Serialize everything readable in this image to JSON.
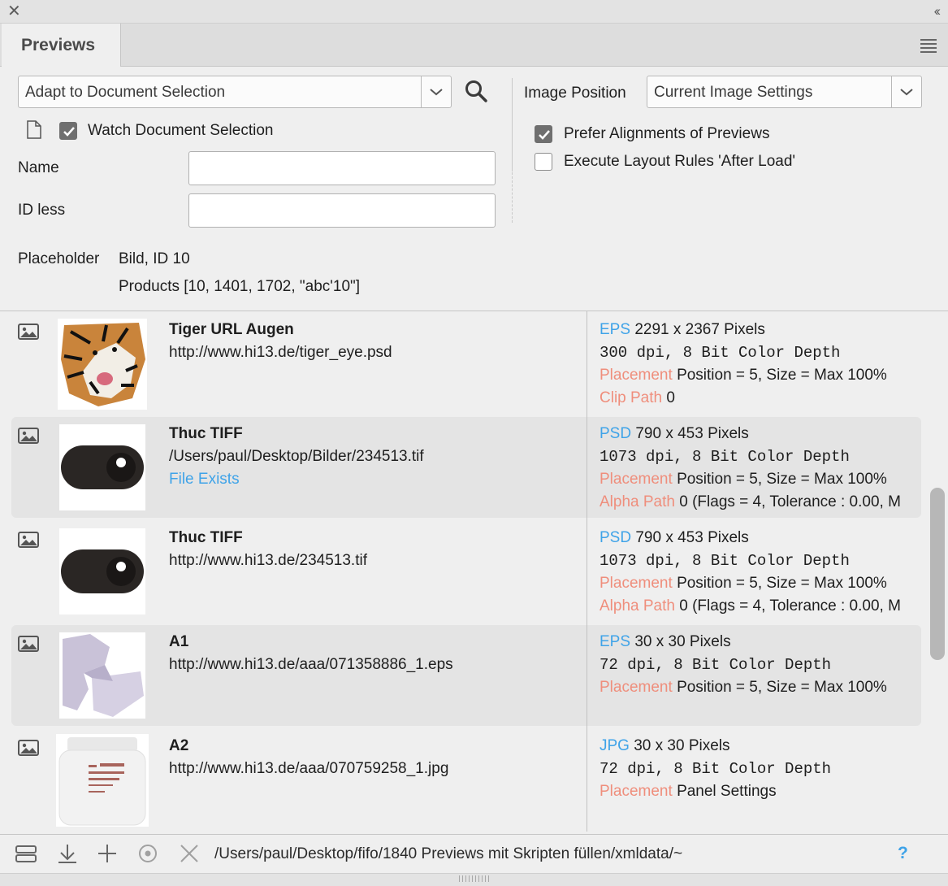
{
  "window": {
    "close_glyph": "✕",
    "collapse_glyph": "‹‹"
  },
  "tab": {
    "label": "Previews"
  },
  "search": {
    "mode_value": "Adapt to Document Selection",
    "watch_label": "Watch Document Selection",
    "watch_checked": true
  },
  "fields": {
    "name_label": "Name",
    "name_value": "",
    "idless_label": "ID less",
    "idless_value": ""
  },
  "placeholder": {
    "label": "Placeholder",
    "line1": "Bild, ID 10",
    "line2": "Products [10, 1401, 1702, \"abc'10\"]"
  },
  "image_position": {
    "label": "Image Position",
    "value": "Current Image Settings",
    "prefer_label": "Prefer Alignments of Previews",
    "prefer_checked": true,
    "execute_label": "Execute Layout Rules 'After Load'",
    "execute_checked": false
  },
  "rows": [
    {
      "title": "Tiger URL Augen",
      "url": "http://www.hi13.de/tiger_eye.psd",
      "exists": "",
      "format": "EPS",
      "size": "2291 x 2367 Pixels",
      "dpi": "300 dpi, 8 Bit Color Depth",
      "k3": "Placement",
      "v3": "Position = 5, Size = Max 100%",
      "k4": "Clip Path",
      "v4": "0",
      "thumb": "tiger"
    },
    {
      "title": "Thuc TIFF",
      "url": "/Users/paul/Desktop/Bilder/234513.tif",
      "exists": "File Exists",
      "format": "PSD",
      "size": "790 x 453 Pixels",
      "dpi": "1073 dpi, 8 Bit Color Depth",
      "k3": "Placement",
      "v3": "Position = 5, Size = Max 100%",
      "k4": "Alpha Path",
      "v4": "0 (Flags = 4, Tolerance : 0.00, M",
      "thumb": "toggle"
    },
    {
      "title": "Thuc TIFF",
      "url": "http://www.hi13.de/234513.tif",
      "exists": "",
      "format": "PSD",
      "size": "790 x 453 Pixels",
      "dpi": "1073 dpi, 8 Bit Color Depth",
      "k3": "Placement",
      "v3": "Position = 5, Size = Max 100%",
      "k4": "Alpha Path",
      "v4": "0 (Flags = 4, Tolerance : 0.00, M",
      "thumb": "toggle"
    },
    {
      "title": "A1",
      "url": "http://www.hi13.de/aaa/071358886_1.eps",
      "exists": "",
      "format": "EPS",
      "size": "30 x 30 Pixels",
      "dpi": "72 dpi, 8 Bit Color Depth",
      "k3": "Placement",
      "v3": "Position = 5, Size = Max 100%",
      "k4": "",
      "v4": "",
      "thumb": "lavender"
    },
    {
      "title": "A2",
      "url": "http://www.hi13.de/aaa/070759258_1.jpg",
      "exists": "",
      "format": "JPG",
      "size": "30 x 30 Pixels",
      "dpi": "72 dpi, 8 Bit Color Depth",
      "k3": "Placement",
      "v3": "Panel Settings",
      "k4": "",
      "v4": "",
      "thumb": "jar"
    }
  ],
  "bottom": {
    "path": "/Users/paul/Desktop/fifo/1840 Previews mit Skripten füllen/xmldata/~",
    "help": "?"
  },
  "colors": {
    "accent_blue": "#3fa3e8",
    "key_salmon": "#ef8e7c"
  }
}
